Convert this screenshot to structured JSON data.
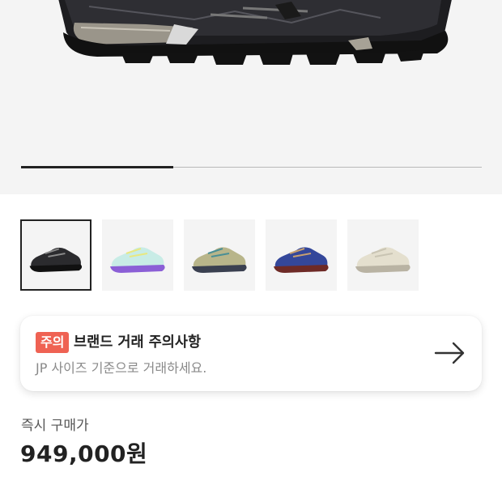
{
  "gallery": {
    "main_image": "black-trail-shoe-image",
    "progress": 0.33,
    "thumbnails": [
      {
        "name": "black",
        "upper": "#2b2b2e",
        "sole": "#111111",
        "accent": "#8b8b8b"
      },
      {
        "name": "mint-purple",
        "upper": "#c8ece6",
        "sole": "#8b5fd6",
        "accent": "#e8e880"
      },
      {
        "name": "khaki-navy",
        "upper": "#b8b58a",
        "sole": "#3a4050",
        "accent": "#4a8f95"
      },
      {
        "name": "navy-burgundy",
        "upper": "#34479a",
        "sole": "#6e2a26",
        "accent": "#c8a070"
      },
      {
        "name": "cream-grey",
        "upper": "#e4dfce",
        "sole": "#b9b3a3",
        "accent": "#c9c4b3"
      }
    ]
  },
  "notice": {
    "badge": "주의",
    "title": "브랜드 거래 주의사항",
    "description": "JP 사이즈 기준으로 거래하세요.",
    "arrow_icon": "arrow-right-icon"
  },
  "price": {
    "label": "즉시 구매가",
    "value": "949,000원"
  }
}
